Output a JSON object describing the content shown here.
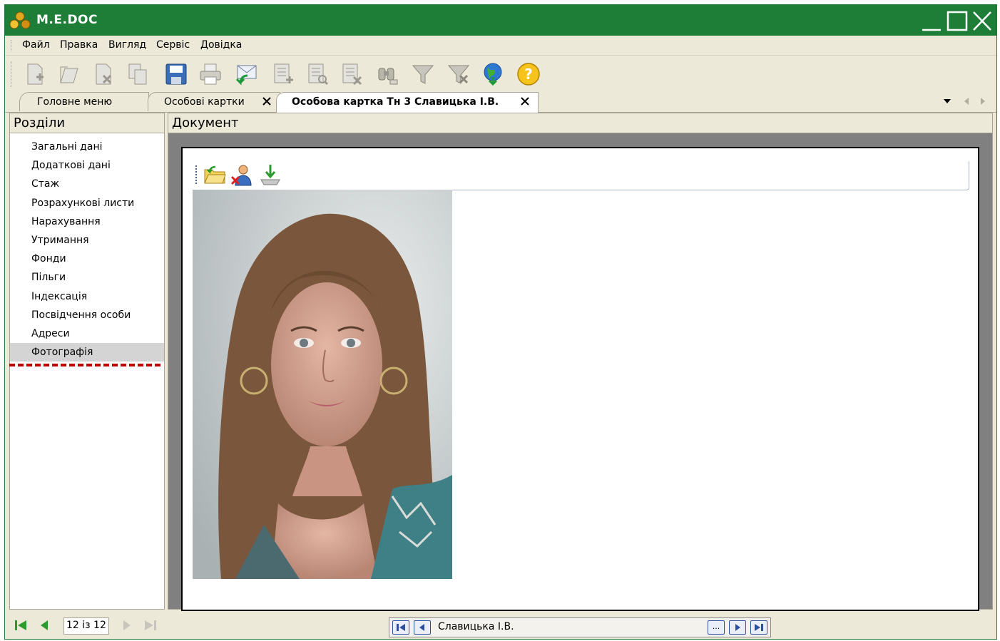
{
  "window": {
    "title": "M.E.DOC",
    "minimize_icon": "minimize-icon",
    "maximize_icon": "maximize-icon",
    "close_icon": "close-icon"
  },
  "menu": {
    "items": [
      "Файл",
      "Правка",
      "Вигляд",
      "Сервіс",
      "Довідка"
    ]
  },
  "toolbar": {
    "icons": [
      "new-document-icon",
      "open-document-icon",
      "delete-document-icon",
      "copy-document-icon",
      "save-icon",
      "print-icon",
      "receive-mail-icon",
      "add-row-icon",
      "view-row-icon",
      "delete-row-icon",
      "find-icon",
      "filter-icon",
      "clear-filter-icon",
      "internet-icon",
      "help-icon"
    ]
  },
  "tabs": [
    {
      "label": "Головне меню",
      "closable": false,
      "active": false
    },
    {
      "label": "Особові картки",
      "closable": true,
      "active": false
    },
    {
      "label": "Особова картка Тн 3 Славицька І.В.",
      "closable": true,
      "active": true
    }
  ],
  "left_panel": {
    "title": "Розділи",
    "sections": [
      "Загальні дані",
      "Додаткові дані",
      "Стаж",
      "Розрахункові листи",
      "Нарахування",
      "Утримання",
      "Фонди",
      "Пільги",
      "Індексація",
      "Посвідчення особи",
      "Адреси",
      "Фотографія"
    ],
    "selected_index": 11,
    "record_counter": "12 із 12"
  },
  "right_panel": {
    "title": "Документ",
    "doc_toolbar_icons": [
      "load-photo-icon",
      "delete-photo-icon",
      "save-photo-icon"
    ],
    "photo_icon": "portrait-photo"
  },
  "bottom_nav": {
    "record_name": "Славицька І.В.",
    "more_label": "..."
  },
  "colors": {
    "titlebar": "#1e7d37",
    "chrome": "#ece9d8",
    "selected_row": "#d4d4d4",
    "selection_marker": "#c00000"
  }
}
